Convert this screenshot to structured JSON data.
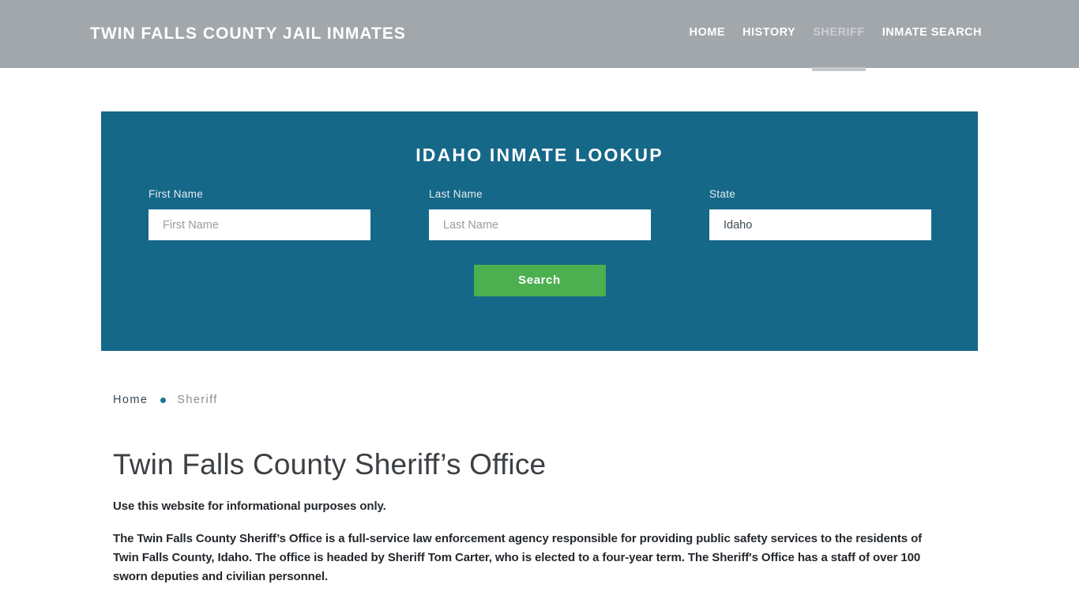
{
  "header": {
    "brand": "Twin Falls County Jail Inmates",
    "nav": [
      {
        "label": "Home",
        "active": false
      },
      {
        "label": "History",
        "active": false
      },
      {
        "label": "Sheriff",
        "active": true
      },
      {
        "label": "Inmate Search",
        "active": false
      }
    ]
  },
  "search_panel": {
    "title": "Idaho Inmate Lookup",
    "first_name": {
      "label": "First Name",
      "placeholder": "First Name",
      "value": ""
    },
    "last_name": {
      "label": "Last Name",
      "placeholder": "Last Name",
      "value": ""
    },
    "state": {
      "label": "State",
      "selected": "Idaho"
    },
    "submit_label": "Search"
  },
  "breadcrumb": {
    "home": "Home",
    "current": "Sheriff"
  },
  "main": {
    "title": "Twin Falls County Sheriff’s Office",
    "lead": "Use this website for informational purposes only.",
    "paragraph": "The Twin Falls County Sheriff’s Office is a full-service law enforcement agency responsible for providing public safety services to the residents of Twin Falls County, Idaho. The office is headed by Sheriff Tom Carter, who is elected to a four-year term. The Sheriff's Office has a staff of over 100 sworn deputies and civilian personnel."
  },
  "colors": {
    "header_bg": "#a2a7ab",
    "panel_bg": "#166888",
    "button_bg": "#4caf50",
    "accent_dot": "#1d7490",
    "page_bg": "#ffffff",
    "text_dark": "#24282c"
  }
}
